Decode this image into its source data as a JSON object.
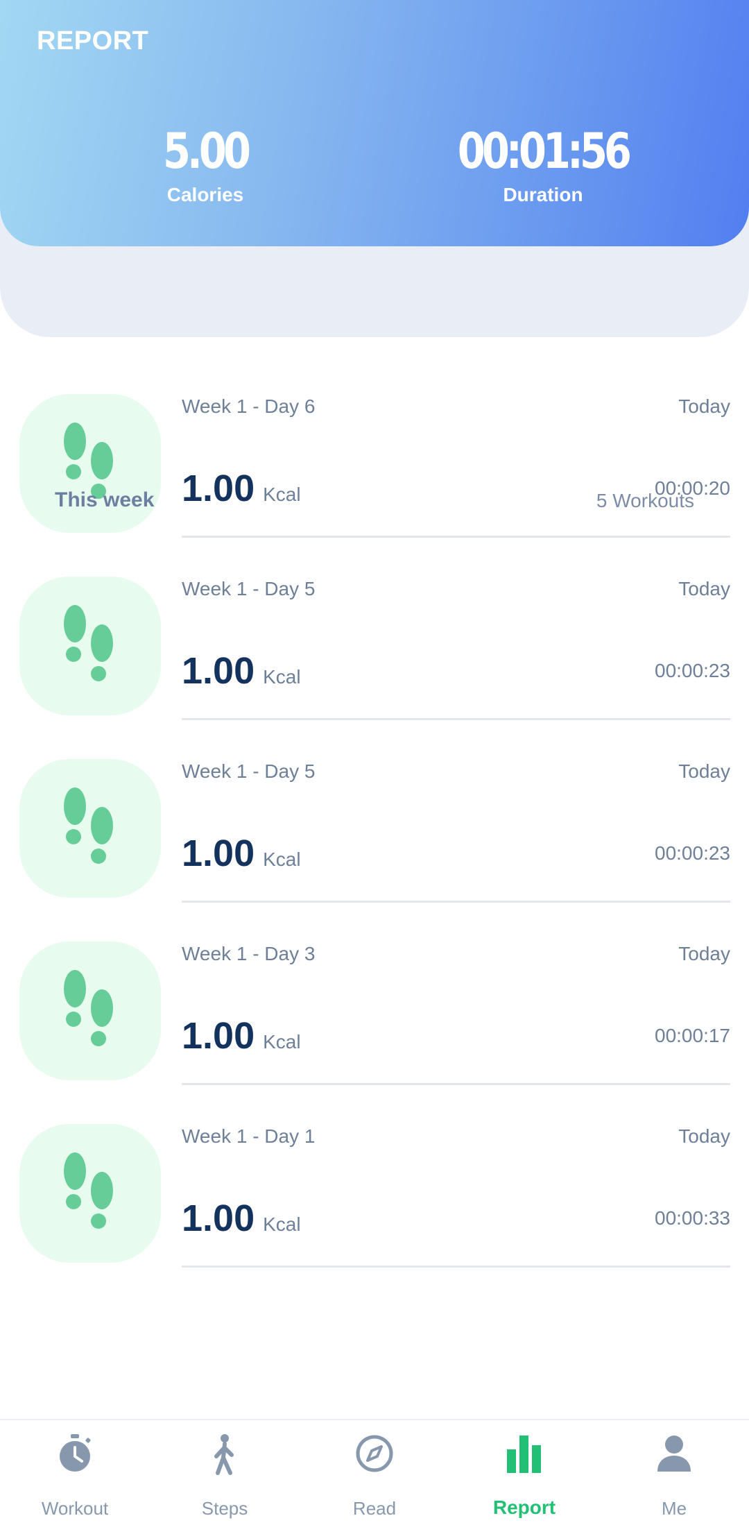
{
  "header": {
    "title": "REPORT"
  },
  "stats": {
    "calories": {
      "value": "5.00",
      "label": "Calories"
    },
    "duration": {
      "value": "00:01:56",
      "label": "Duration"
    }
  },
  "summary": {
    "period": "This week",
    "count": "5 Workouts"
  },
  "workouts": [
    {
      "title": "Week 1 - Day 6",
      "date": "Today",
      "kcal": "1.00",
      "unit": "Kcal",
      "time": "00:00:20",
      "icon": "footprints-icon"
    },
    {
      "title": "Week 1 - Day 5",
      "date": "Today",
      "kcal": "1.00",
      "unit": "Kcal",
      "time": "00:00:23",
      "icon": "footprints-icon"
    },
    {
      "title": "Week 1 - Day 5",
      "date": "Today",
      "kcal": "1.00",
      "unit": "Kcal",
      "time": "00:00:23",
      "icon": "footprints-icon"
    },
    {
      "title": "Week 1 - Day 3",
      "date": "Today",
      "kcal": "1.00",
      "unit": "Kcal",
      "time": "00:00:17",
      "icon": "footprints-icon"
    },
    {
      "title": "Week 1 - Day 1",
      "date": "Today",
      "kcal": "1.00",
      "unit": "Kcal",
      "time": "00:00:33",
      "icon": "footprints-icon"
    }
  ],
  "nav": {
    "items": [
      {
        "label": "Workout",
        "icon": "stopwatch-icon"
      },
      {
        "label": "Steps",
        "icon": "walking-person-icon"
      },
      {
        "label": "Read",
        "icon": "compass-icon"
      },
      {
        "label": "Report",
        "icon": "bar-chart-icon",
        "active": true
      },
      {
        "label": "Me",
        "icon": "person-icon"
      }
    ],
    "active_color": "#22c074",
    "inactive_color": "#8798ad"
  },
  "colors": {
    "header_start": "#a2d8f3",
    "header_end": "#527ff0",
    "accent_green": "#22c074"
  }
}
